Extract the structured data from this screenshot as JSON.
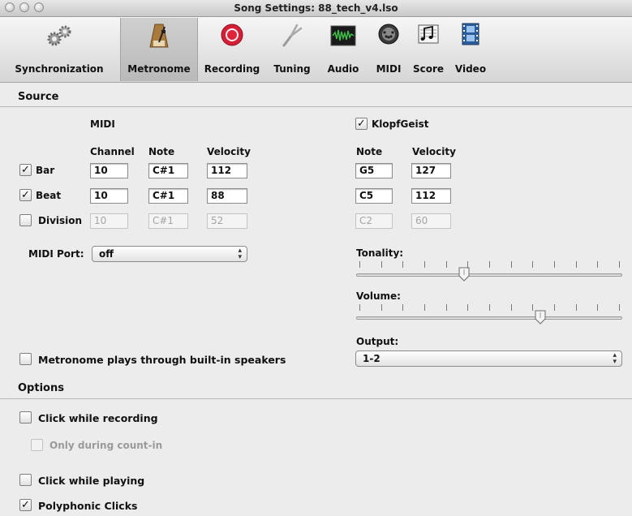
{
  "window": {
    "title": "Song Settings: 88_tech_v4.lso"
  },
  "toolbar": {
    "items": [
      {
        "label": "Synchronization",
        "icon": "gears-icon"
      },
      {
        "label": "Metronome",
        "icon": "metronome-icon",
        "active": true
      },
      {
        "label": "Recording",
        "icon": "record-icon"
      },
      {
        "label": "Tuning",
        "icon": "tuning-fork-icon"
      },
      {
        "label": "Audio",
        "icon": "waveform-icon"
      },
      {
        "label": "MIDI",
        "icon": "midi-port-icon"
      },
      {
        "label": "Score",
        "icon": "music-notes-icon"
      },
      {
        "label": "Video",
        "icon": "film-icon"
      }
    ]
  },
  "source": {
    "title": "Source",
    "midi_header": "MIDI",
    "columns": {
      "channel": "Channel",
      "note": "Note",
      "velocity": "Velocity"
    },
    "rows": [
      {
        "label": "Bar",
        "checked": true,
        "channel": "10",
        "note": "C#1",
        "velocity": "112",
        "kg_note": "G5",
        "kg_velocity": "127",
        "enabled": true
      },
      {
        "label": "Beat",
        "checked": true,
        "channel": "10",
        "note": "C#1",
        "velocity": "88",
        "kg_note": "C5",
        "kg_velocity": "112",
        "enabled": true
      },
      {
        "label": "Division",
        "checked": false,
        "channel": "10",
        "note": "C#1",
        "velocity": "52",
        "kg_note": "C2",
        "kg_velocity": "60",
        "enabled": false
      }
    ],
    "klopfgeist": {
      "label": "KlopfGeist",
      "checked": true,
      "note_header": "Note",
      "velocity_header": "Velocity"
    },
    "midi_port": {
      "label": "MIDI Port:",
      "value": "off"
    },
    "tonality": {
      "label": "Tonality:",
      "level": 0.4
    },
    "volume": {
      "label": "Volume:",
      "level": 0.7
    },
    "output": {
      "label": "Output:",
      "value": "1-2"
    },
    "builtin_speakers": {
      "label": "Metronome plays through built-in speakers",
      "checked": false
    }
  },
  "options": {
    "title": "Options",
    "click_while_recording": {
      "label": "Click while recording",
      "checked": false
    },
    "only_during_countin": {
      "label": "Only during count-in",
      "checked": false,
      "enabled": false
    },
    "click_while_playing": {
      "label": "Click while playing",
      "checked": false
    },
    "polyphonic_clicks": {
      "label": "Polyphonic Clicks",
      "checked": true
    }
  },
  "glyphs": {
    "check": "✓",
    "popup_arrows": "▲▼"
  },
  "colors": {
    "record_red": "#e0223a",
    "audio_green": "#3fbf4a",
    "window_bg": "#ececec"
  }
}
